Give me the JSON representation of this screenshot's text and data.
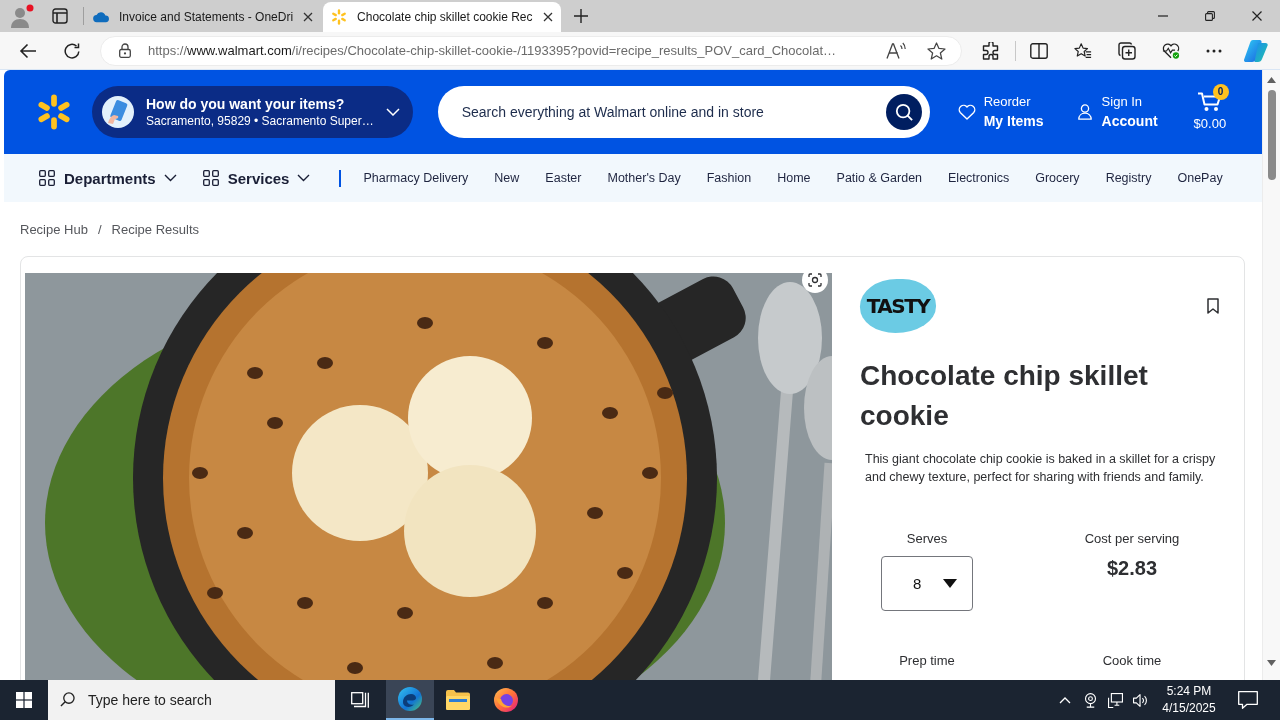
{
  "browser": {
    "tabs": [
      {
        "kind": "cloud",
        "title": "Invoice and Statements - OneDri",
        "selected": false
      },
      {
        "kind": "spark",
        "title": "Chocolate chip skillet cookie Rec",
        "selected": true
      }
    ],
    "url": {
      "scheme": "https://",
      "host": "www.walmart.com",
      "path": "/i/recipes/Chocolate-chip-skillet-cookie-/1193395?povid=recipe_results_POV_card_Chocolat…"
    }
  },
  "header": {
    "fulfillment": {
      "title": "How do you want your items?",
      "subtitle": "Sacramento, 95829 • Sacramento Super…"
    },
    "search": {
      "placeholder": "Search everything at Walmart online and in store"
    },
    "reorder": {
      "label": "Reorder",
      "title": "My Items"
    },
    "account": {
      "label": "Sign In",
      "title": "Account"
    },
    "cart": {
      "count": "0",
      "total": "$0.00"
    }
  },
  "nav": {
    "menus": [
      "Departments",
      "Services"
    ],
    "links": [
      "Pharmacy Delivery",
      "New",
      "Easter",
      "Mother's Day",
      "Fashion",
      "Home",
      "Patio & Garden",
      "Electronics",
      "Grocery",
      "Registry",
      "OnePay"
    ]
  },
  "breadcrumb": {
    "items": [
      "Recipe Hub",
      "Recipe Results"
    ],
    "separator": "/"
  },
  "recipe": {
    "brand": "TASTY",
    "title": "Chocolate chip skillet cookie",
    "description": "This giant chocolate chip cookie is baked in a skillet for a crispy and chewy texture, perfect for sharing with friends and family.",
    "stats": [
      {
        "kind": "select",
        "label": "Serves",
        "value": "8"
      },
      {
        "kind": "value",
        "label": "Cost per serving",
        "value": "$2.83"
      },
      {
        "kind": "label",
        "label": "Prep time"
      },
      {
        "kind": "label",
        "label": "Cook time"
      }
    ]
  },
  "taskbar": {
    "search": {
      "placeholder": "Type here to search"
    },
    "apps": [
      {
        "kind": "browser",
        "selected": true
      },
      {
        "kind": "folder",
        "selected": false
      },
      {
        "kind": "fox",
        "selected": false
      }
    ],
    "time": "5:24 PM",
    "date": "4/15/2025"
  }
}
